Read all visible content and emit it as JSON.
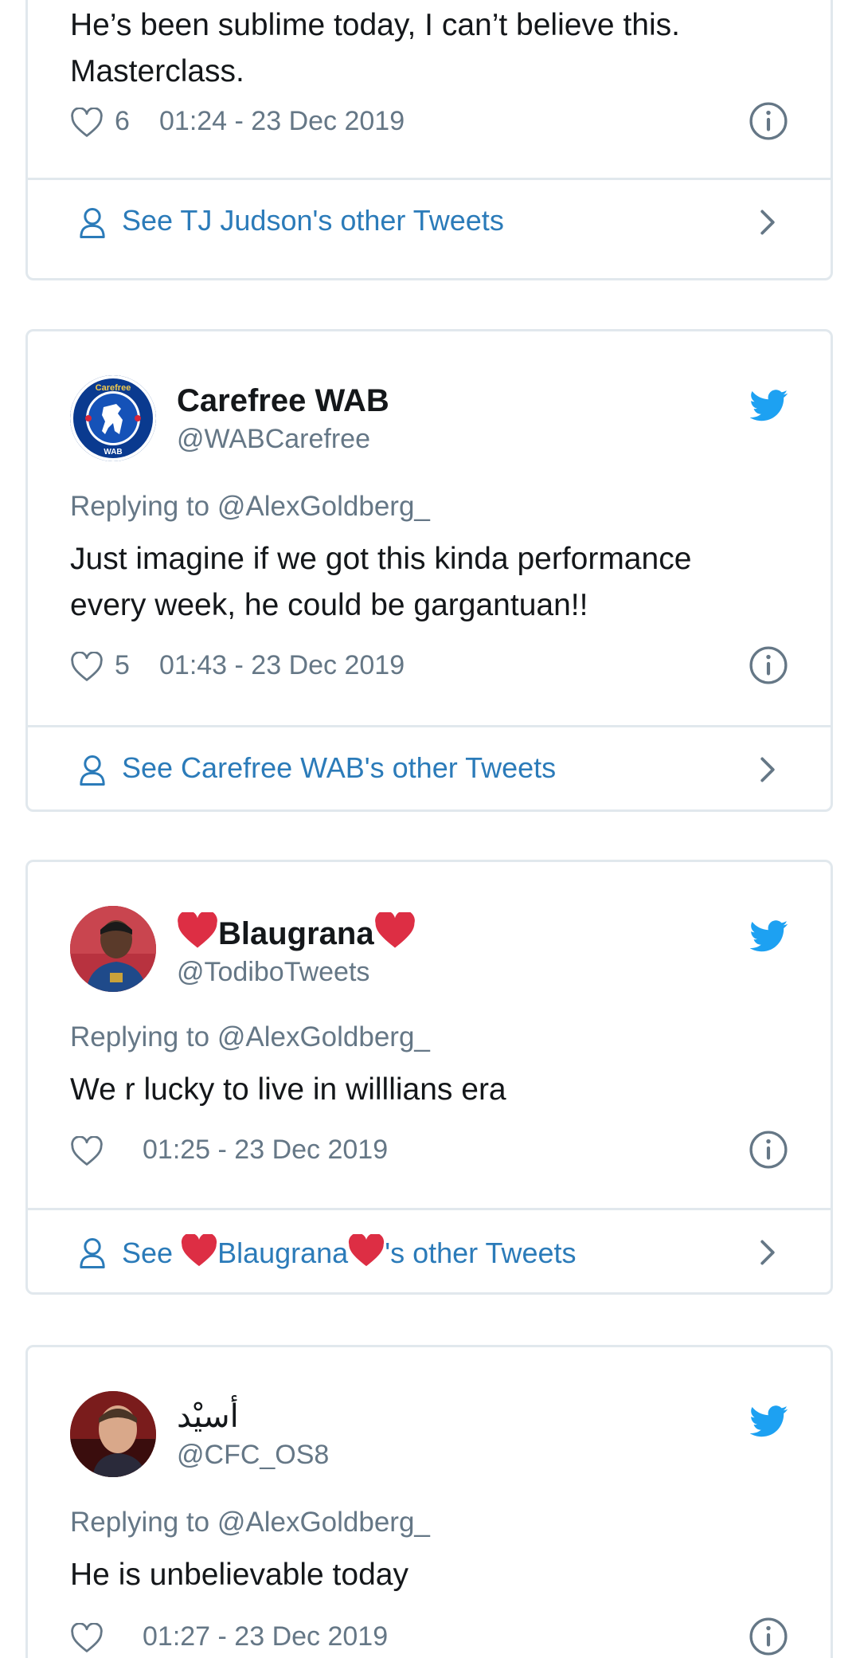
{
  "tweets": [
    {
      "text": "He’s been sublime today, I can’t believe this. Masterclass.",
      "likes": "6",
      "timestamp": "01:24 - 23 Dec 2019",
      "footer": "See TJ Judson's other Tweets"
    },
    {
      "display_name": "Carefree WAB",
      "handle": "@WABCarefree",
      "avatar_text_top": "Carefree",
      "avatar_text_bottom": "WAB",
      "replying_to": "Replying to @AlexGoldberg_",
      "text": "Just imagine if we got this kinda performance every week, he could be gargantuan!!",
      "likes": "5",
      "timestamp": "01:43 - 23 Dec 2019",
      "footer": "See Carefree WAB's other Tweets"
    },
    {
      "display_name": "Blaugrana",
      "handle": "@TodiboTweets",
      "replying_to": "Replying to @AlexGoldberg_",
      "text": "We r lucky to live in willlians era",
      "likes": "",
      "timestamp": "01:25 - 23 Dec 2019",
      "footer_prefix": "See ",
      "footer_name": "Blaugrana",
      "footer_suffix": "'s other Tweets"
    },
    {
      "display_name": "أسيْد",
      "handle": "@CFC_OS8",
      "replying_to": "Replying to @AlexGoldberg_",
      "text": "He is unbelievable today",
      "likes": "",
      "timestamp": "01:27 - 23 Dec 2019"
    }
  ],
  "icons": {
    "like": "heart-outline-icon",
    "info": "info-icon",
    "bird": "twitter-bird-icon",
    "person": "person-icon",
    "chevron": "chevron-right-icon"
  },
  "colors": {
    "link": "#2b7bb9",
    "twitter_blue": "#1da1f2",
    "muted": "#657786",
    "border": "#e1e8ed",
    "emoji_heart": "#dd2e44"
  }
}
